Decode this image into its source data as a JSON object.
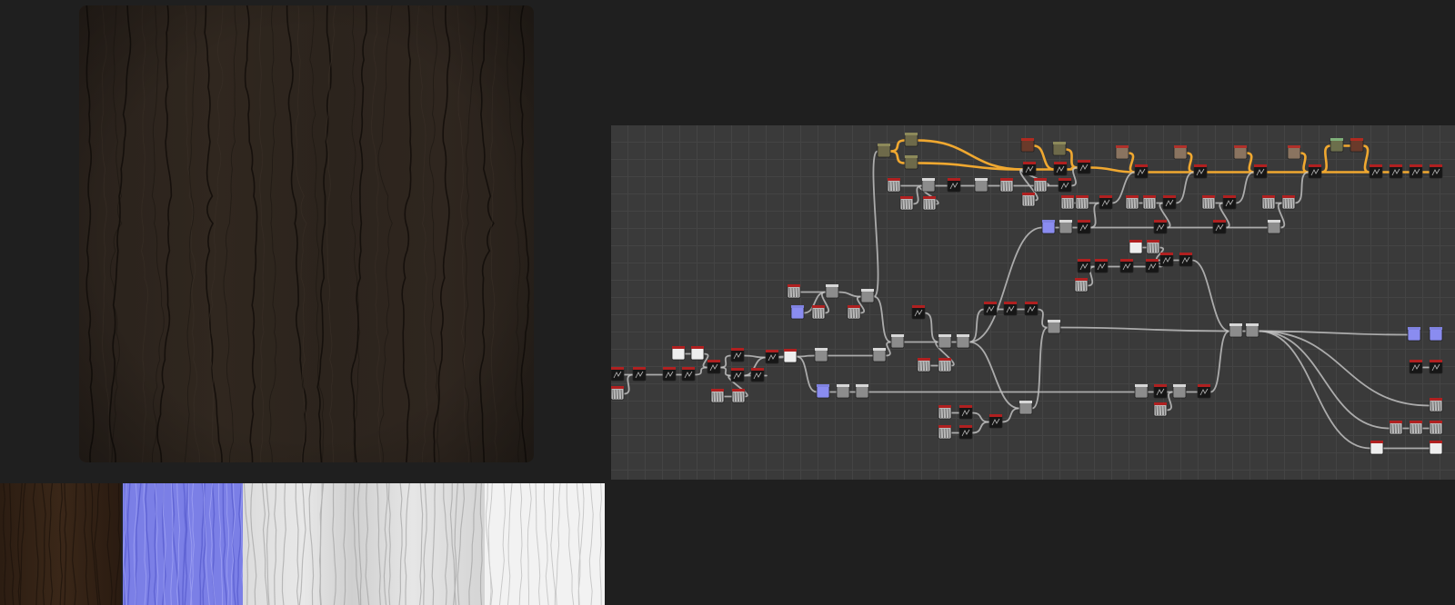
{
  "colors": {
    "background": "#1f1f1f",
    "graph_background": "#3a3a3a",
    "grid_line": "#444444",
    "wire_default": "#bfbfbf",
    "wire_highlight": "#f0a830",
    "node_header_red": "#b02020",
    "node_header_green": "#6fb07a",
    "node_header_teal": "#4a9aa8",
    "normal_map": "#7b7fe6",
    "wood_dark": "#2b231d"
  },
  "preview": {
    "material": "dark-wood-planks"
  },
  "output_maps": [
    {
      "kind": "base-color",
      "tone": "dark-brown"
    },
    {
      "kind": "normal",
      "tone": "blue-violet"
    },
    {
      "kind": "roughness",
      "tone": "light-gray"
    },
    {
      "kind": "height",
      "tone": "white"
    }
  ],
  "graph": {
    "panel": "node-graph-editor"
  }
}
